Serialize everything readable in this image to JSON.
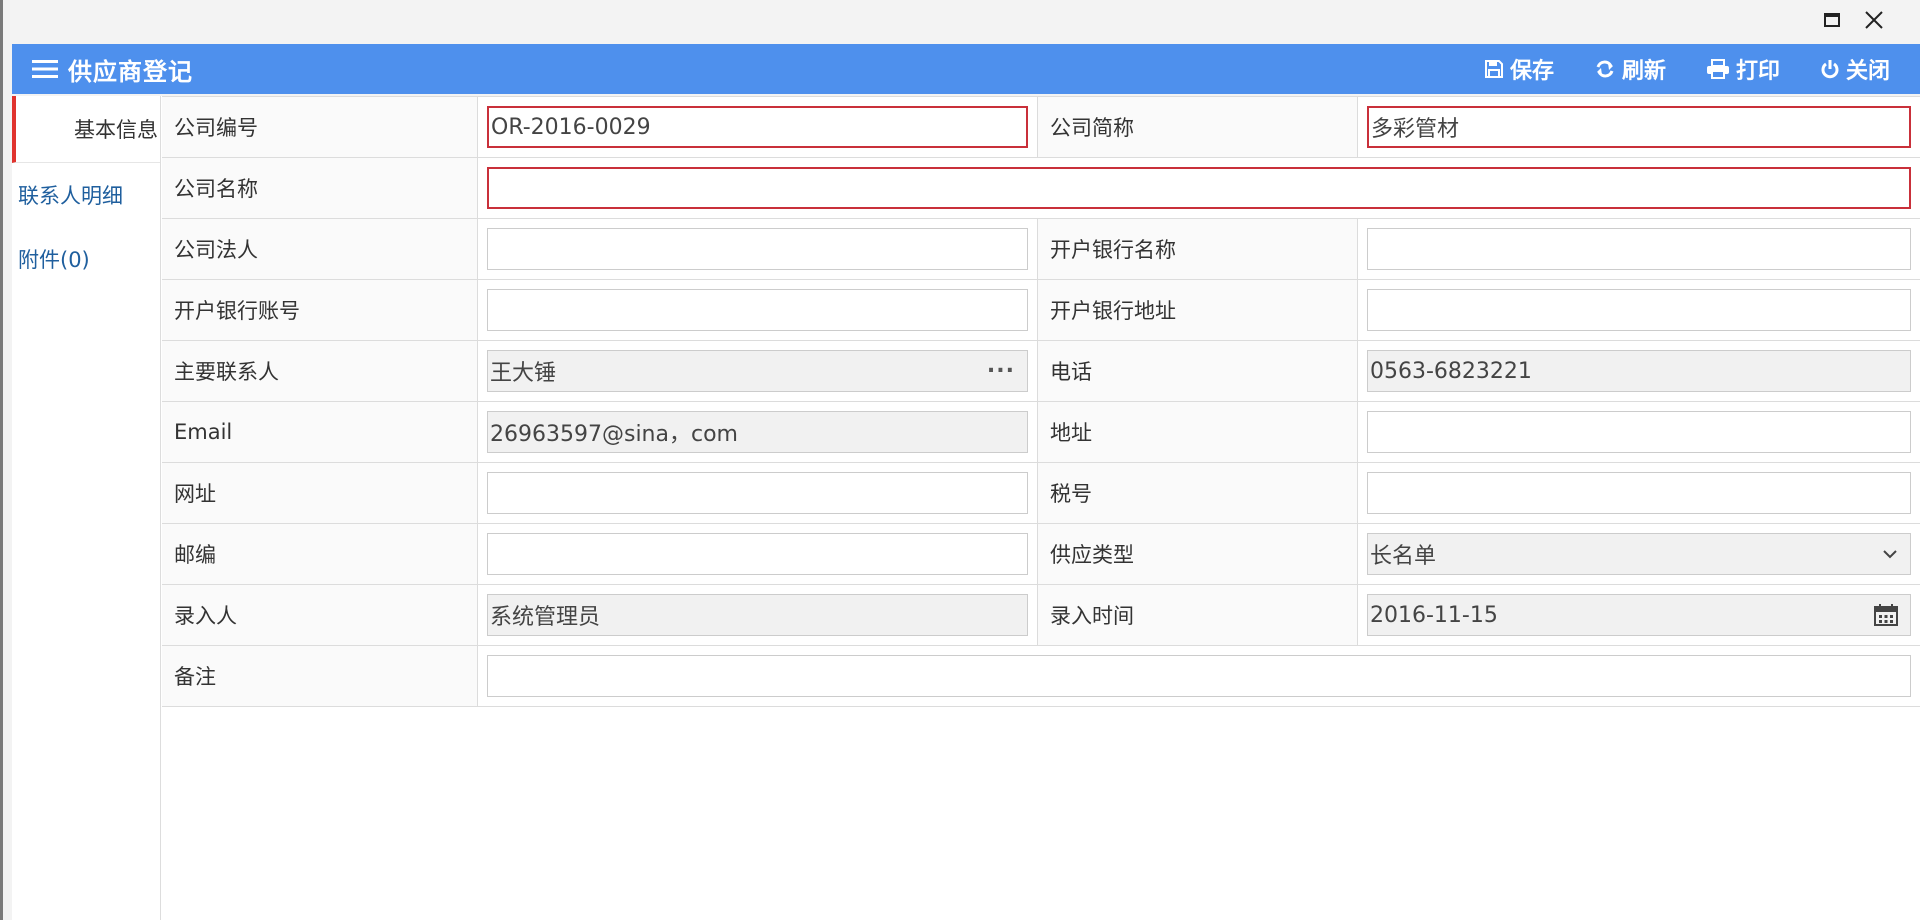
{
  "window": {
    "controls": [
      {
        "name": "maximize",
        "icon": "maximize-icon"
      },
      {
        "name": "close",
        "icon": "close-icon"
      }
    ]
  },
  "header": {
    "title": "供应商登记",
    "menu_icon": "hamburger-menu-icon",
    "background": "#4e90ed",
    "toolbar": {
      "save": "保存",
      "refresh": "刷新",
      "print": "打印",
      "close": "关闭"
    }
  },
  "sidebar": {
    "tabs": [
      {
        "label": "基本信息",
        "active": true
      },
      {
        "label": "联系人明细",
        "active": false
      },
      {
        "label": "附件(0)",
        "active": false
      }
    ]
  },
  "form": {
    "company_code": {
      "label": "公司编号",
      "value": "OR-2016-0029"
    },
    "company_short": {
      "label": "公司简称",
      "value": "多彩管材"
    },
    "company_name": {
      "label": "公司名称",
      "value": ""
    },
    "legal_person": {
      "label": "公司法人",
      "value": ""
    },
    "bank_name": {
      "label": "开户银行名称",
      "value": ""
    },
    "bank_account": {
      "label": "开户银行账号",
      "value": ""
    },
    "bank_address": {
      "label": "开户银行地址",
      "value": ""
    },
    "main_contact": {
      "label": "主要联系人",
      "value": "王大锤",
      "suffix": "···"
    },
    "phone": {
      "label": "电话",
      "value": "0563-6823221"
    },
    "email": {
      "label": "Email",
      "value": "26963597@sina，com"
    },
    "address": {
      "label": "地址",
      "value": ""
    },
    "website": {
      "label": "网址",
      "value": ""
    },
    "tax_no": {
      "label": "税号",
      "value": ""
    },
    "postcode": {
      "label": "邮编",
      "value": ""
    },
    "supply_type": {
      "label": "供应类型",
      "value": "长名单"
    },
    "entered_by": {
      "label": "录入人",
      "value": "系统管理员"
    },
    "entry_time": {
      "label": "录入时间",
      "value": "2016-11-15"
    },
    "remarks": {
      "label": "备注",
      "value": ""
    }
  },
  "colors": {
    "accent": "#4e90ed",
    "required_border": "#c9303a",
    "active_tab_marker": "#e0332e",
    "link": "#1f5f9e"
  }
}
